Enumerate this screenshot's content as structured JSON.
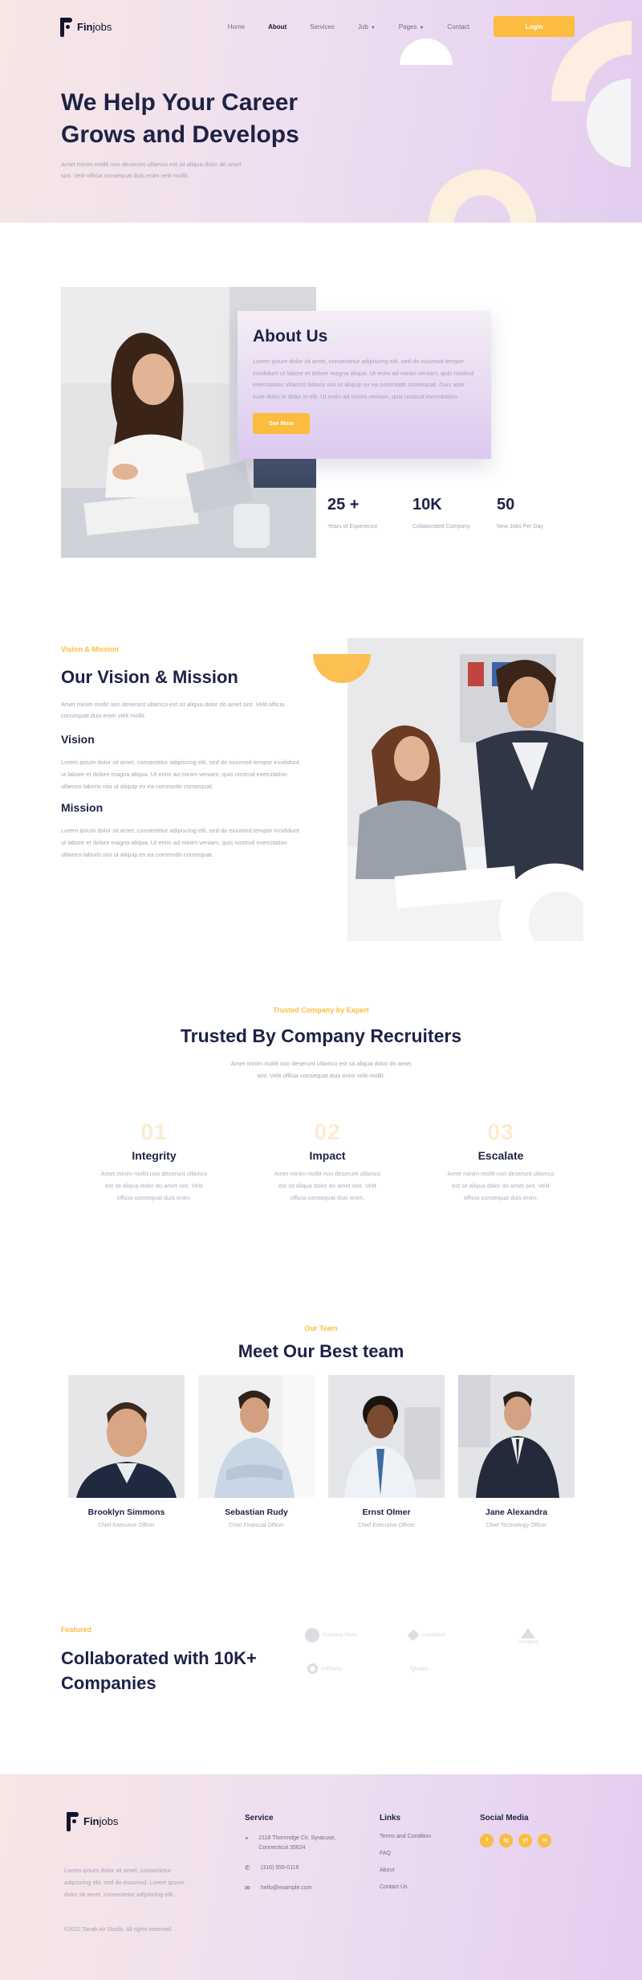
{
  "brand": {
    "name_bold": "Fin",
    "name_rest": "jobs"
  },
  "nav": {
    "items": [
      {
        "label": "Home"
      },
      {
        "label": "About"
      },
      {
        "label": "Services"
      },
      {
        "label": "Job"
      },
      {
        "label": "Pages"
      },
      {
        "label": "Contact"
      }
    ],
    "active": "About",
    "login": "Login"
  },
  "hero": {
    "title_line1": "We Help Your Career",
    "title_line2": "Grows and Develops",
    "subtitle": "Amet minim mollit non deserunt ullamco est sit aliqua dolor do amet sint. Velit officia consequat duis enim velit mollit."
  },
  "about": {
    "title": "About Us",
    "body": "Lorem ipsum dolor sit amet, consectetur adipiscing elit, sed do eiusmod tempor incididunt ut labore et dolore magna aliqua. Ut enim ad minim veniam, quis nostrud exercitation ullamco laboris nisi ut aliquip ex ea commodo consequat. Duis aute irure dolor in dolor in elit. Ut enim ad minim veniam, quis nostrud exercitation.",
    "button": "See More",
    "stats": [
      {
        "value": "25 +",
        "label": "Years of Experience"
      },
      {
        "value": "10K",
        "label": "Collaborated Company"
      },
      {
        "value": "50",
        "label": "New Jobs Per Day"
      }
    ]
  },
  "vision": {
    "eyebrow": "Vision & Mission",
    "title": "Our Vision & Mission",
    "intro": "Amet minim mollit non deserunt ullamco est sit aliqua dolor do amet sint. Velit officia consequat duis enim velit mollit.",
    "vision_title": "Vision",
    "vision_text": "Lorem ipsum dolor sit amet, consectetur adipiscing elit, sed do eiusmod tempor incididunt ut labore et dolore magna aliqua. Ut enim ad minim veniam, quis nostrud exercitation ullamco laboris nisi ut aliquip ex ea commodo consequat.",
    "mission_title": "Mission",
    "mission_text": "Lorem ipsum dolor sit amet, consectetur adipiscing elit, sed do eiusmod tempor incididunt ut labore et dolore magna aliqua. Ut enim ad minim veniam, quis nostrud exercitation ullamco laboris nisi ut aliquip ex ea commodo consequat."
  },
  "trusted": {
    "eyebrow": "Trusted Company by Expert",
    "title": "Trusted By Company Recruiters",
    "intro": "Amet minim mollit non deserunt ullamco est sit aliqua dolor do amet sint. Velit officia consequat duis enim velit mollit.",
    "values": [
      {
        "num": "01",
        "title": "Integrity",
        "text": "Amet minim mollit non deserunt ullamco est sit aliqua dolor do amet sint. Velit officia consequat duis enim."
      },
      {
        "num": "02",
        "title": "Impact",
        "text": "Amet minim mollit non deserunt ullamco est sit aliqua dolor do amet sint. Velit officia consequat duis enim."
      },
      {
        "num": "03",
        "title": "Escalate",
        "text": "Amet minim mollit non deserunt ullamco est sit aliqua dolor do amet sint. Velit officia consequat duis enim."
      }
    ]
  },
  "team": {
    "eyebrow": "Our Team",
    "title": "Meet Our Best team",
    "members": [
      {
        "name": "Brooklyn Simmons",
        "role": "Chief Executive Officer"
      },
      {
        "name": "Sebastian Rudy",
        "role": "Chief Financial Officer"
      },
      {
        "name": "Ernst Olmer",
        "role": "Chief Executive Officer"
      },
      {
        "name": "Jane Alexandra",
        "role": "Chief Technology Officer"
      }
    ]
  },
  "partners": {
    "eyebrow": "Featured",
    "title": "Collaborated with 10K+ Companies",
    "logos": [
      "Company Name",
      "Logoipsum",
      "Company",
      "Company",
      "Ipsum"
    ]
  },
  "footer": {
    "description": "Lorem ipsum dolor sit amet, consectetur adipiscing elit, sed do eiusmod. Lorem ipsum dolor sit amet, consectetur adipiscing elit.",
    "copyright": "©2022 Tanah Air Studio. All rights reserved.",
    "service_title": "Service",
    "address": "2118 Thornridge Cir. Syracuse, Connecticut 35624",
    "phone": "(316) 555-0116",
    "email": "hello@example.com",
    "links_title": "Links",
    "links": [
      "Terms and Condition",
      "FAQ",
      "About",
      "Contact Us"
    ],
    "social_title": "Social Media",
    "socials": [
      "f",
      "ig",
      "yt",
      "in"
    ]
  },
  "colors": {
    "accent": "#fbbc3f",
    "navy": "#1d2246",
    "lavender": "#e3cdef"
  }
}
